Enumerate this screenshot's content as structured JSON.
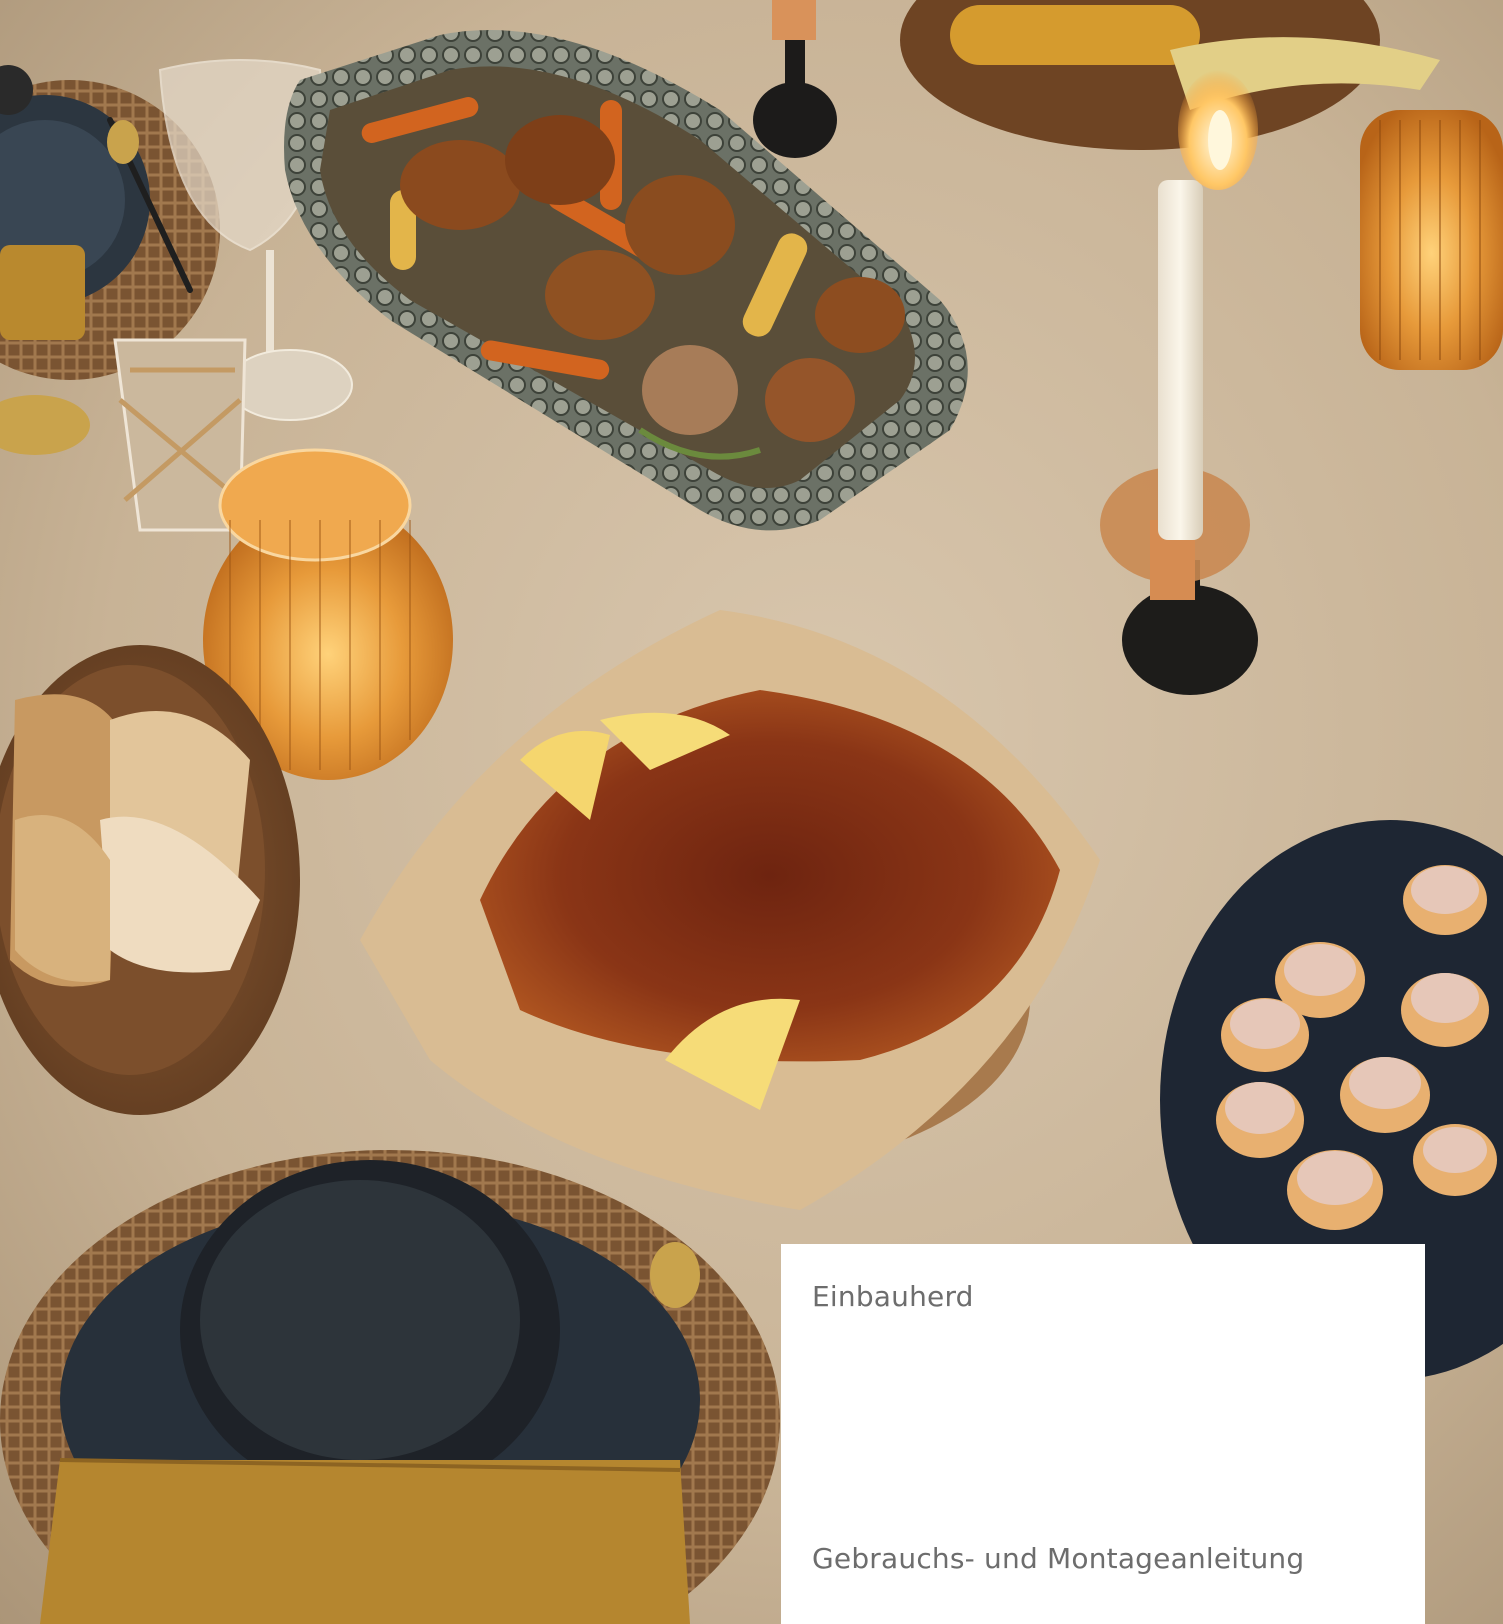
{
  "cover": {
    "product_type": "Einbauherd",
    "document_title": "Gebrauchs- und Montageanleitung"
  },
  "colors": {
    "tablecloth": "#cdb9a0",
    "card_background": "#ffffff",
    "text": "#6d6d6d"
  }
}
